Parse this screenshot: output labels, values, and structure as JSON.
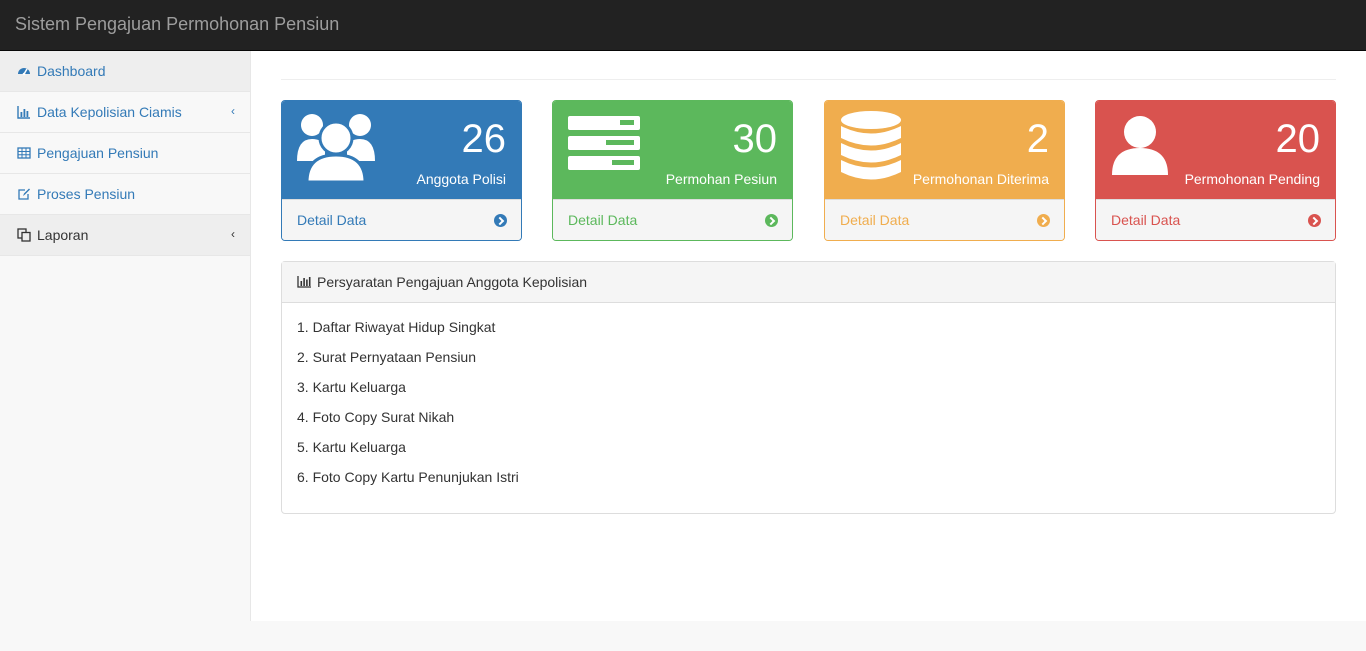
{
  "app": {
    "title": "Sistem Pengajuan Permohonan Pensiun"
  },
  "sidebar": {
    "items": [
      {
        "label": "Dashboard",
        "icon": "dashboard-icon",
        "has_submenu": false
      },
      {
        "label": "Data Kepolisian Ciamis",
        "icon": "bar-chart-icon",
        "has_submenu": true
      },
      {
        "label": "Pengajuan Pensiun",
        "icon": "table-icon",
        "has_submenu": false
      },
      {
        "label": "Proses Pensiun",
        "icon": "edit-icon",
        "has_submenu": false
      },
      {
        "label": "Laporan",
        "icon": "copy-icon",
        "has_submenu": true
      }
    ]
  },
  "cards": [
    {
      "value": "26",
      "label": "Anggota Polisi",
      "footer": "Detail Data",
      "icon": "users-icon",
      "color": "#337ab7"
    },
    {
      "value": "30",
      "label": "Permohan Pesiun",
      "footer": "Detail Data",
      "icon": "server-icon",
      "color": "#5cb85c"
    },
    {
      "value": "2",
      "label": "Permohonan Diterima",
      "footer": "Detail Data",
      "icon": "database-icon",
      "color": "#f0ad4e"
    },
    {
      "value": "20",
      "label": "Permohonan Pending",
      "footer": "Detail Data",
      "icon": "user-icon",
      "color": "#d9534f"
    }
  ],
  "panel": {
    "title": "Persyaratan Pengajuan Anggota Kepolisian",
    "items": [
      "1. Daftar Riwayat Hidup Singkat",
      "2. Surat Pernyataan Pensiun",
      "3. Kartu Keluarga",
      "4. Foto Copy Surat Nikah",
      "5. Kartu Keluarga",
      "6. Foto Copy Kartu Penunjukan Istri"
    ]
  }
}
